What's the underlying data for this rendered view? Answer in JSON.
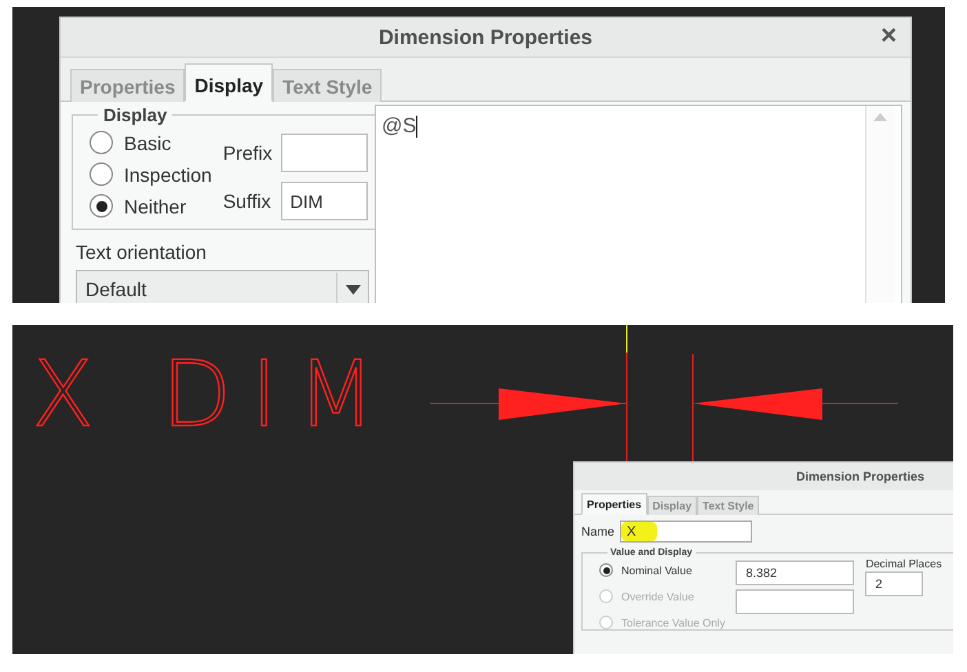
{
  "top_dialog": {
    "title": "Dimension Properties",
    "close": "×",
    "tabs": [
      {
        "label": "Properties",
        "selected": false
      },
      {
        "label": "Display",
        "selected": true
      },
      {
        "label": "Text Style",
        "selected": false
      }
    ],
    "display_group": {
      "title": "Display",
      "options": [
        {
          "label": "Basic",
          "selected": false
        },
        {
          "label": "Inspection",
          "selected": false
        },
        {
          "label": "Neither",
          "selected": true
        }
      ],
      "prefix_label": "Prefix",
      "suffix_label": "Suffix",
      "suffix_value": "DIM"
    },
    "text_orientation": {
      "label": "Text orientation",
      "value": "Default"
    },
    "text_area": {
      "value": "@S"
    }
  },
  "canvas": {
    "dimension_text": "X DIM"
  },
  "bottom_dialog": {
    "title": "Dimension Properties",
    "tabs": [
      {
        "label": "Properties",
        "selected": true
      },
      {
        "label": "Display",
        "selected": false
      },
      {
        "label": "Text Style",
        "selected": false
      }
    ],
    "name": {
      "label": "Name",
      "value": "X",
      "highlighted": true
    },
    "group_title": "Value and Display",
    "options": [
      {
        "label": "Nominal Value",
        "selected": true,
        "disabled": false
      },
      {
        "label": "Override Value",
        "selected": false,
        "disabled": true
      },
      {
        "label": "Tolerance Value Only",
        "selected": false,
        "disabled": true
      }
    ],
    "nominal_value": "8.382",
    "decimal_places": {
      "label": "Decimal Places",
      "value": "2"
    }
  }
}
